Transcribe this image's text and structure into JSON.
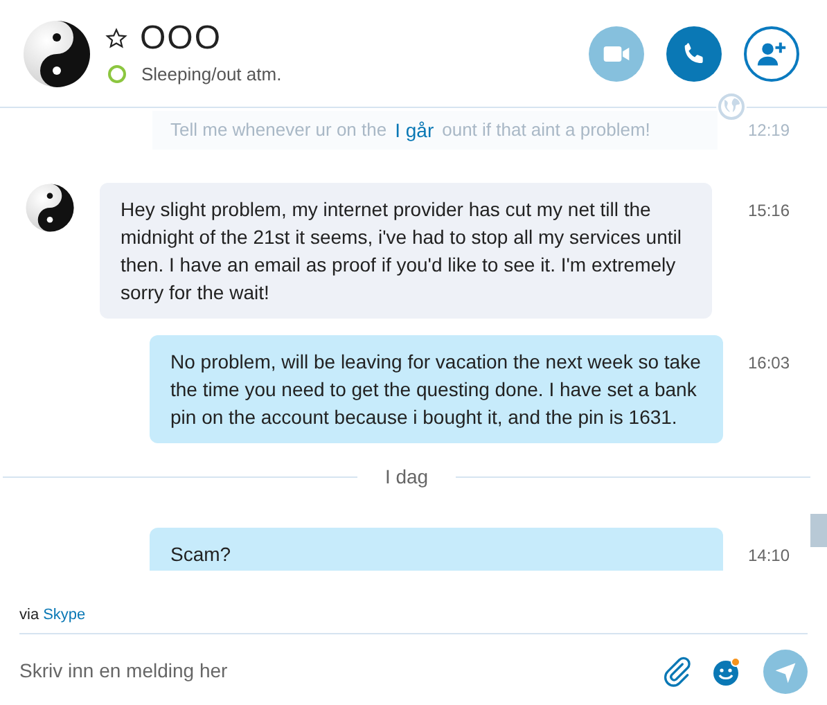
{
  "contact": {
    "name": "OOO",
    "favorite": false,
    "mood": "Sleeping/out atm.",
    "online": true
  },
  "header_buttons": [
    {
      "kind": "video",
      "enabled": false
    },
    {
      "kind": "call",
      "enabled": true
    },
    {
      "kind": "add",
      "enabled": true
    }
  ],
  "faded_message": {
    "before": "Tell me whenever ur on the",
    "after": "ount if that aint a problem!",
    "time": "12:19"
  },
  "messages": [
    {
      "kind": "date",
      "label": "I går"
    },
    {
      "kind": "received",
      "text": "Hey slight problem, my internet provider has cut my net till the midnight of the 21st it seems, i've had to stop all my services until then. I have an email as proof if you'd like to see it. I'm extremely sorry for the wait!",
      "time": "15:16"
    },
    {
      "kind": "sent",
      "text": "No problem, will be leaving for vacation the next week so take the time you need to get the questing done. I have set a bank pin on the account because i bought it, and the pin is 1631.",
      "time": "16:03"
    },
    {
      "kind": "date",
      "label": "I dag"
    },
    {
      "kind": "sent",
      "text": "Scam?",
      "time": "14:10"
    }
  ],
  "via": {
    "prefix": "via",
    "link": "Skype"
  },
  "composer": {
    "placeholder": "Skriv inn en melding her"
  }
}
